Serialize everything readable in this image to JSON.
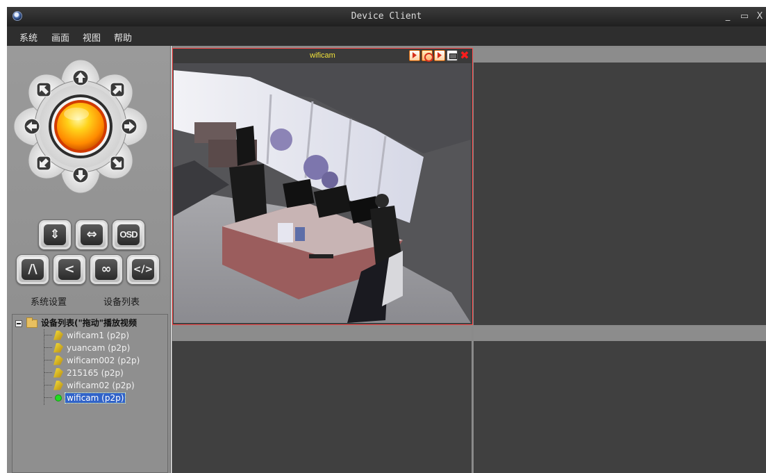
{
  "window": {
    "title": "Device Client",
    "controls": {
      "minimize": "_",
      "maximize": "▭",
      "close": "X"
    }
  },
  "menu": [
    "系统",
    "画面",
    "视图",
    "帮助"
  ],
  "ptz": {
    "directions": [
      "up",
      "down",
      "left",
      "right",
      "up-left",
      "up-right",
      "down-left",
      "down-right"
    ],
    "center": "center-button",
    "buttons": {
      "vertical_glyph": "⇕",
      "horizontal_glyph": "⇔",
      "osd": "OSD",
      "flip_glyph": "/\\",
      "mirror_glyph": "<",
      "infinity_glyph": "∞",
      "code_glyph": "</>"
    }
  },
  "labels": {
    "system_settings": "系统设置",
    "device_list": "设备列表"
  },
  "tree": {
    "root": "设备列表(\"拖动\"播放视频",
    "items": [
      {
        "label": "wificam1 (p2p)",
        "status": "offline"
      },
      {
        "label": "yuancam (p2p)",
        "status": "offline"
      },
      {
        "label": "wificam002 (p2p)",
        "status": "offline"
      },
      {
        "label": "215165 (p2p)",
        "status": "offline"
      },
      {
        "label": "wificam02 (p2p)",
        "status": "offline"
      },
      {
        "label": "wificam (p2p)",
        "status": "online",
        "selected": true
      }
    ]
  },
  "panes": {
    "active_title": "wificam",
    "tool_icons": [
      "record-icon",
      "snapshot-icon",
      "talk-icon",
      "capture-icon",
      "close-icon"
    ],
    "close_glyph": "✖"
  },
  "colors": {
    "active_border": "#ff4b4b",
    "pane_title": "#f0e23a",
    "selection": "#3163c8",
    "online": "#22dd22"
  }
}
